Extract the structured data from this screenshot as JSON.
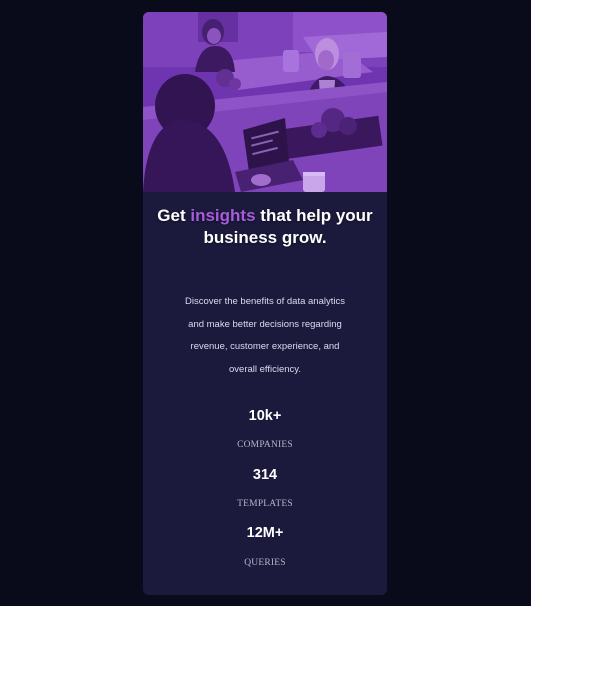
{
  "card": {
    "image_alt": "Team working together at an office table",
    "title_before": "Get",
    "title_accent": "insights",
    "title_after": "that help your business grow.",
    "description": "Discover the benefits of data analytics and make better decisions regarding revenue, customer experience, and overall efficiency.",
    "stats": [
      {
        "value": "10k+",
        "label": "COMPANIES"
      },
      {
        "value": "314",
        "label": "TEMPLATES"
      },
      {
        "value": "12M+",
        "label": "QUERIES"
      }
    ]
  },
  "colors": {
    "page_background": "#0a0b1a",
    "card_background": "#1c1a3c",
    "accent": "#a75cd9",
    "image_overlay": "#8a3fd1"
  }
}
